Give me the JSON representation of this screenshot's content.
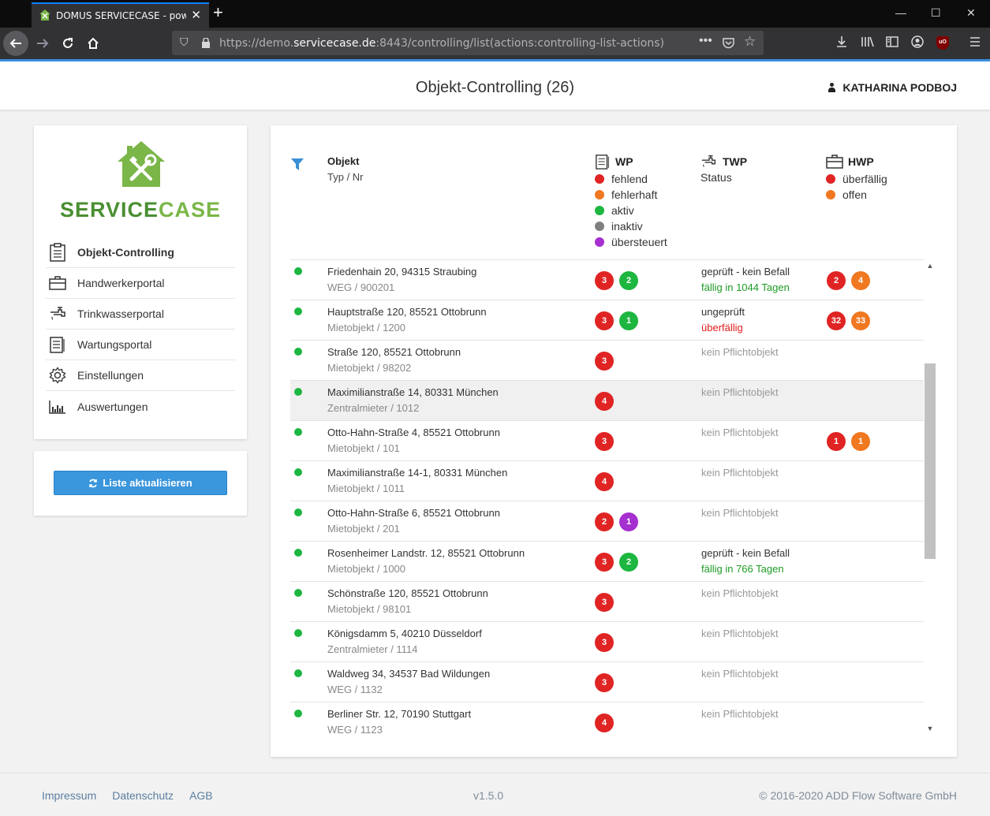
{
  "browser": {
    "tab_title": "DOMUS SERVICECASE - powered",
    "tab_close": "✕",
    "new_tab": "+",
    "url_prefix": "https://demo.",
    "url_host": "servicecase.de",
    "url_path": ":8443/controlling/list(actions:controlling-list-actions)",
    "icons": [
      "back-icon",
      "forward-icon",
      "reload-icon",
      "home-icon",
      "shield-icon",
      "lock-icon",
      "more-icon",
      "pocket-icon",
      "star-icon",
      "download-icon",
      "library-icon",
      "sidebar-icon",
      "account-icon",
      "ublock-icon",
      "menu-icon"
    ]
  },
  "header": {
    "title": "Objekt-Controlling (26)",
    "user": "KATHARINA PODBOJ"
  },
  "logo": {
    "part1": "SERVICE",
    "part2": "CASE"
  },
  "menu": [
    {
      "label": "Objekt-Controlling",
      "icon": "clipboard-icon",
      "active": true
    },
    {
      "label": "Handwerkerportal",
      "icon": "toolbox-icon",
      "active": false
    },
    {
      "label": "Trinkwasserportal",
      "icon": "faucet-icon",
      "active": false
    },
    {
      "label": "Wartungsportal",
      "icon": "document-icon",
      "active": false
    },
    {
      "label": "Einstellungen",
      "icon": "gear-icon",
      "active": false
    },
    {
      "label": "Auswertungen",
      "icon": "chart-icon",
      "active": false
    }
  ],
  "refresh_button": "Liste aktualisieren",
  "table": {
    "col_object": {
      "title": "Objekt",
      "sub": "Typ / Nr"
    },
    "col_wp": {
      "title": "WP",
      "legend": [
        {
          "label": "fehlend",
          "color": "#e02424"
        },
        {
          "label": "fehlerhaft",
          "color": "#f07820"
        },
        {
          "label": "aktiv",
          "color": "#1db640"
        },
        {
          "label": "inaktiv",
          "color": "#808080"
        },
        {
          "label": "übersteuert",
          "color": "#a52fcf"
        }
      ]
    },
    "col_twp": {
      "title": "TWP",
      "sub": "Status"
    },
    "col_hwp": {
      "title": "HWP",
      "legend": [
        {
          "label": "überfällig",
          "color": "#e02424"
        },
        {
          "label": "offen",
          "color": "#f07820"
        }
      ]
    },
    "rows": [
      {
        "addr": "Friedenhain 20, 94315 Straubing",
        "typ": "WEG / 900201",
        "wp": [
          {
            "v": "3",
            "c": "#e02424"
          },
          {
            "v": "2",
            "c": "#1db640"
          }
        ],
        "twp1": "geprüft - kein Befall",
        "twp1c": "dark",
        "twp2": "fällig in 1044 Tagen",
        "twp2c": "green",
        "hwp": [
          {
            "v": "2",
            "c": "#e02424"
          },
          {
            "v": "4",
            "c": "#f07820"
          }
        ]
      },
      {
        "addr": "Hauptstraße 120, 85521 Ottobrunn",
        "typ": "Mietobjekt / 1200",
        "wp": [
          {
            "v": "3",
            "c": "#e02424"
          },
          {
            "v": "1",
            "c": "#1db640"
          }
        ],
        "twp1": "ungeprüft",
        "twp1c": "dark",
        "twp2": "überfällig",
        "twp2c": "red",
        "hwp": [
          {
            "v": "32",
            "c": "#e02424"
          },
          {
            "v": "33",
            "c": "#f07820"
          }
        ]
      },
      {
        "addr": "Straße 120, 85521 Ottobrunn",
        "typ": "Mietobjekt / 98202",
        "wp": [
          {
            "v": "3",
            "c": "#e02424"
          }
        ],
        "twp1": "kein Pflichtobjekt",
        "twp1c": "grey",
        "twp2": "",
        "twp2c": "grey",
        "hwp": []
      },
      {
        "addr": "Maximilianstraße 14, 80331 München",
        "typ": "Zentralmieter / 1012",
        "wp": [
          {
            "v": "4",
            "c": "#e02424"
          }
        ],
        "twp1": "kein Pflichtobjekt",
        "twp1c": "grey",
        "twp2": "",
        "twp2c": "grey",
        "hwp": [],
        "highlight": true
      },
      {
        "addr": "Otto-Hahn-Straße 4, 85521 Ottobrunn",
        "typ": "Mietobjekt / 101",
        "wp": [
          {
            "v": "3",
            "c": "#e02424"
          }
        ],
        "twp1": "kein Pflichtobjekt",
        "twp1c": "grey",
        "twp2": "",
        "twp2c": "grey",
        "hwp": [
          {
            "v": "1",
            "c": "#e02424"
          },
          {
            "v": "1",
            "c": "#f07820"
          }
        ]
      },
      {
        "addr": "Maximilianstraße 14-1, 80331 München",
        "typ": "Mietobjekt / 1011",
        "wp": [
          {
            "v": "4",
            "c": "#e02424"
          }
        ],
        "twp1": "kein Pflichtobjekt",
        "twp1c": "grey",
        "twp2": "",
        "twp2c": "grey",
        "hwp": []
      },
      {
        "addr": "Otto-Hahn-Straße 6, 85521 Ottobrunn",
        "typ": "Mietobjekt / 201",
        "wp": [
          {
            "v": "2",
            "c": "#e02424"
          },
          {
            "v": "1",
            "c": "#a52fcf"
          }
        ],
        "twp1": "kein Pflichtobjekt",
        "twp1c": "grey",
        "twp2": "",
        "twp2c": "grey",
        "hwp": []
      },
      {
        "addr": "Rosenheimer Landstr. 12, 85521 Ottobrunn",
        "typ": "Mietobjekt / 1000",
        "wp": [
          {
            "v": "3",
            "c": "#e02424"
          },
          {
            "v": "2",
            "c": "#1db640"
          }
        ],
        "twp1": "geprüft - kein Befall",
        "twp1c": "dark",
        "twp2": "fällig in 766 Tagen",
        "twp2c": "green",
        "hwp": []
      },
      {
        "addr": "Schönstraße 120, 85521 Ottobrunn",
        "typ": "Mietobjekt / 98101",
        "wp": [
          {
            "v": "3",
            "c": "#e02424"
          }
        ],
        "twp1": "kein Pflichtobjekt",
        "twp1c": "grey",
        "twp2": "",
        "twp2c": "grey",
        "hwp": []
      },
      {
        "addr": "Königsdamm 5, 40210 Düsseldorf",
        "typ": "Zentralmieter / 1114",
        "wp": [
          {
            "v": "3",
            "c": "#e02424"
          }
        ],
        "twp1": "kein Pflichtobjekt",
        "twp1c": "grey",
        "twp2": "",
        "twp2c": "grey",
        "hwp": []
      },
      {
        "addr": "Waldweg 34, 34537 Bad Wildungen",
        "typ": "WEG / 1132",
        "wp": [
          {
            "v": "3",
            "c": "#e02424"
          }
        ],
        "twp1": "kein Pflichtobjekt",
        "twp1c": "grey",
        "twp2": "",
        "twp2c": "grey",
        "hwp": []
      },
      {
        "addr": "Berliner Str. 12, 70190 Stuttgart",
        "typ": "WEG / 1123",
        "wp": [
          {
            "v": "4",
            "c": "#e02424"
          }
        ],
        "twp1": "kein Pflichtobjekt",
        "twp1c": "grey",
        "twp2": "",
        "twp2c": "grey",
        "hwp": []
      }
    ]
  },
  "footer": {
    "links": [
      "Impressum",
      "Datenschutz",
      "AGB"
    ],
    "version": "v1.5.0",
    "copyright": "© 2016-2020 ADD Flow Software GmbH"
  }
}
